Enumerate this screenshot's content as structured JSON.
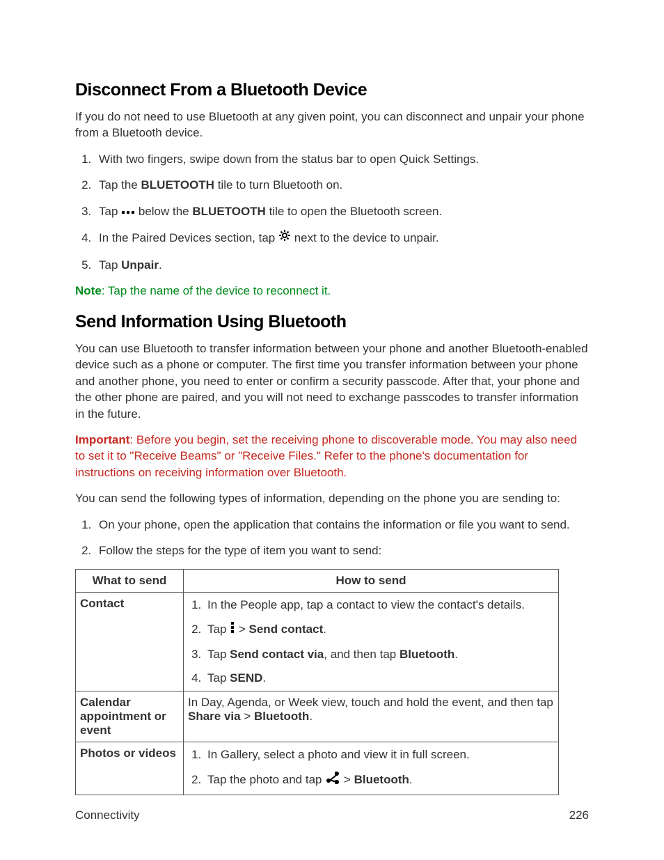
{
  "section1": {
    "heading": "Disconnect From a Bluetooth Device",
    "intro": "If you do not need to use Bluetooth at any given point, you can disconnect and unpair your phone from a Bluetooth device.",
    "steps": {
      "s1": "With two fingers, swipe down from the status bar to open Quick Settings.",
      "s2_a": "Tap the ",
      "s2_b": "BLUETOOTH",
      "s2_c": " tile to turn Bluetooth on.",
      "s3_a": "Tap ",
      "s3_b": " below the ",
      "s3_c": "BLUETOOTH",
      "s3_d": " tile to open the Bluetooth screen.",
      "s4_a": "In the Paired Devices section, tap ",
      "s4_b": " next to the device to unpair.",
      "s5_a": "Tap ",
      "s5_b": "Unpair",
      "s5_c": "."
    },
    "note_label": "Note",
    "note_text": ": Tap the name of the device to reconnect it."
  },
  "section2": {
    "heading": "Send Information Using Bluetooth",
    "p1": "You can use Bluetooth to transfer information between your phone and another Bluetooth-enabled device such as a phone or computer. The first time you transfer information between your phone and another phone, you need to enter or confirm a security passcode. After that, your phone and the other phone are paired, and you will not need to exchange passcodes to transfer information in the future.",
    "important_label": "Important",
    "important_text": ": Before you begin, set the receiving phone to discoverable mode. You may also need to set it to \"Receive Beams\" or \"Receive Files.\" Refer to the phone's documentation for instructions on receiving information over Bluetooth.",
    "p2": "You can send the following types of information, depending on the phone you are sending to:",
    "steps": {
      "s1": "On your phone, open the application that contains the information or file you want to send.",
      "s2": "Follow the steps for the type of item you want to send:"
    }
  },
  "table": {
    "th1": "What to send",
    "th2": "How to send",
    "row1": {
      "what": "Contact",
      "s1": "In the People app, tap a contact to view the contact's details.",
      "s2_a": "Tap ",
      "s2_b": " > ",
      "s2_c": "Send contact",
      "s2_d": ".",
      "s3_a": "Tap ",
      "s3_b": "Send contact via",
      "s3_c": ", and then tap ",
      "s3_d": "Bluetooth",
      "s3_e": ".",
      "s4_a": "Tap ",
      "s4_b": "SEND",
      "s4_c": "."
    },
    "row2": {
      "what": "Calendar appointment or event",
      "how_a": "In Day, Agenda, or Week view, touch and hold the event, and then tap ",
      "how_b": "Share via",
      "how_c": " > ",
      "how_d": "Bluetooth",
      "how_e": "."
    },
    "row3": {
      "what": "Photos or videos",
      "s1": "In Gallery, select a photo and view it in full screen.",
      "s2_a": "Tap the photo and tap ",
      "s2_b": " > ",
      "s2_c": "Bluetooth",
      "s2_d": "."
    }
  },
  "footer": {
    "left": "Connectivity",
    "right": "226"
  },
  "icons": {
    "dots": "dots-icon",
    "gear": "gear-icon",
    "overflow": "overflow-icon",
    "share": "share-icon"
  }
}
